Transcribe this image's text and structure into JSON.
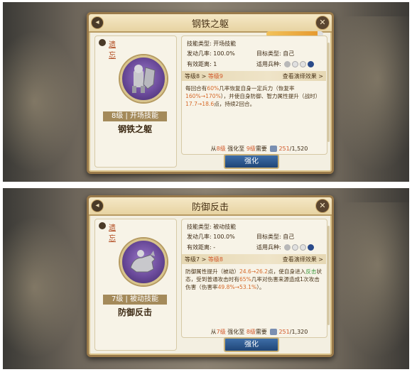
{
  "panels": [
    {
      "title": "钢铁之躯",
      "forget": "遗忘",
      "level_badge": "8级 | 开场技能",
      "skill_name": "钢铁之躯",
      "skill_type": "技能类型: 开场技能",
      "activation": "发动几率: 100.0%",
      "target": "目标类型: 自己",
      "range": "有效距离: 1",
      "applicable": "适用兵种:",
      "level_from": "等级8 >",
      "level_to": "等级9",
      "view_more": "查看演绎效果 >",
      "desc_parts": [
        "每回合有",
        "60%",
        "几率恢复自身一定兵力（恢复率",
        "160%→170%",
        "），并使自身防御、智力属性提升（战时）",
        "17.7→18.6",
        "点，持续2回合。"
      ],
      "cost_prefix": "从",
      "cost_lv_from": "8级",
      "cost_mid": "强化至",
      "cost_lv_to": "9级",
      "cost_need": "需要",
      "cost_have": "251",
      "cost_total": "/1,520",
      "button": "强化",
      "exp_fraction": 0.9
    },
    {
      "title": "防御反击",
      "forget": "遗忘",
      "level_badge": "7级 | 被动技能",
      "skill_name": "防御反击",
      "skill_type": "技能类型: 被动技能",
      "activation": "发动几率: 100.0%",
      "target": "目标类型: 自己",
      "range": "有效距离: -",
      "applicable": "适用兵种:",
      "level_from": "等级7 >",
      "level_to": "等级8",
      "view_more": "查看演绎效果 >",
      "desc_parts": [
        "防御属性提升（被动）",
        "24.6→26.2",
        "点，使自身进入",
        "反击",
        "状态，受到普通攻击时有",
        "65%",
        "几率对伤害来源造成1次攻击伤害（伤害率",
        "49.8%→53.1%",
        "）。"
      ],
      "cost_prefix": "从",
      "cost_lv_from": "7级",
      "cost_mid": "强化至",
      "cost_lv_to": "8级",
      "cost_need": "需要",
      "cost_have": "251",
      "cost_total": "/1,320",
      "button": "强化"
    }
  ],
  "colors": {
    "accent": "#d2582a",
    "button": "#1f4577",
    "frame": "#9a7a4a",
    "highlight_green": "#3f9b3f"
  },
  "icons": [
    "back-icon",
    "close-icon",
    "forget-icon",
    "shield-knight-icon",
    "wolf-cavalry-icon",
    "gem-icon",
    "unit-type-icons",
    "help-icon"
  ]
}
